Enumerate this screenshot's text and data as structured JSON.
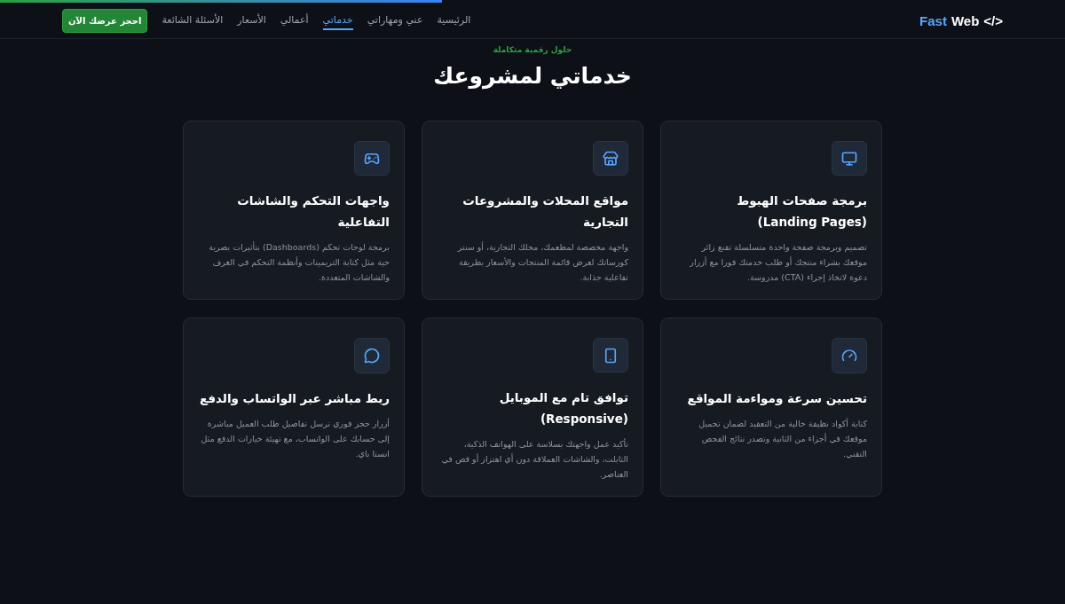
{
  "progress": {
    "level": 0.415
  },
  "logo": {
    "first": "Fast",
    "second": "Web",
    "mark": "</>"
  },
  "nav": [
    {
      "label": "الرئيسية",
      "selected": false
    },
    {
      "label": "عني ومهاراتي",
      "selected": false
    },
    {
      "label": "خدماتي",
      "selected": true
    },
    {
      "label": "أعمالي",
      "selected": false
    },
    {
      "label": "الأسعار",
      "selected": false
    },
    {
      "label": "الأسئلة الشائعة",
      "selected": false
    }
  ],
  "cta": "احجز عرضك الآن",
  "section": {
    "eyebrow": "حلول رقمية متكاملة",
    "title": "خدماتي لمشروعك"
  },
  "services": [
    {
      "title": "برمجة صفحات الهبوط (Landing Pages)",
      "text": "تصميم وبرمجة صفحة واحدة متسلسلة تقنع زائر موقعك بشراء منتجك أو طلب خدمتك فورا مع أزرار دعوة لاتخاذ إجراء (CTA) مدروسة."
    },
    {
      "title": "مواقع المحلات والمشروعات التجارية",
      "text": "واجهة مخصصة لمطعمك، محلك التجارية، أو سنتر كورساتك لعرض قائمة المنتجات والأسعار بطريقة تفاعلية جذابة."
    },
    {
      "title": "واجهات التحكم والشاشات التفاعلية",
      "text": "برمجة لوحات تحكم (Dashboards) بتأثيرات بصرية حية مثل كتابة التريمينات وأنظمة التحكم في الغرف والشاشات المتعددة."
    },
    {
      "title": "تحسين سرعة ومواءمة المواقع",
      "text": "كتابة أكواد نظيفة خالية من التعقيد لضمان تحميل موقعك في أجزاء من الثانية وتصدر نتائج الفحص التقني."
    },
    {
      "title": "توافق تام مع الموبايل (Responsive)",
      "text": "تأكيد عمل واجهتك بسلاسة على الهواتف الذكية، التابلت، والشاشات العملاقة دون أي اهتزاز أو قص في العناصر."
    },
    {
      "title": "ربط مباشر عبر الواتساب والدفع",
      "text": "أزرار حجز فوري ترسل تفاصيل طلب العميل مباشرة إلى حسابك على الواتساب، مع تهيئة خيارات الدفع مثل انستا باي."
    }
  ]
}
